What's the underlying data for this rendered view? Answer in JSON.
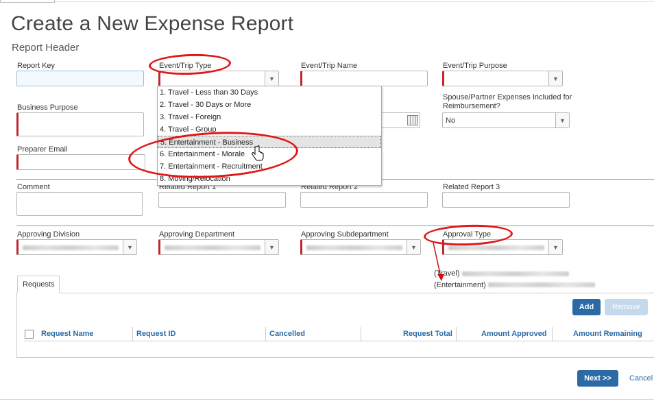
{
  "page": {
    "title": "Create a New Expense Report",
    "subtitle": "Report Header"
  },
  "fields": {
    "report_key": {
      "label": "Report Key",
      "value": ""
    },
    "event_trip_type": {
      "label": "Event/Trip Type",
      "value": ""
    },
    "event_trip_name": {
      "label": "Event/Trip Name",
      "value": ""
    },
    "event_trip_purpose": {
      "label": "Event/Trip Purpose",
      "value": ""
    },
    "business_purpose": {
      "label": "Business Purpose",
      "value": ""
    },
    "spouse_expenses": {
      "label": "Spouse/Partner Expenses Included for Reimbursement?",
      "value": "No"
    },
    "preparer_email": {
      "label": "Preparer Email",
      "value": ""
    },
    "comment": {
      "label": "Comment",
      "value": ""
    },
    "related_report_1": {
      "label": "Related Report 1",
      "value": ""
    },
    "related_report_2": {
      "label": "Related Report 2",
      "value": ""
    },
    "related_report_3": {
      "label": "Related Report 3",
      "value": ""
    },
    "approving_division": {
      "label": "Approving Division"
    },
    "approving_department": {
      "label": "Approving Department"
    },
    "approving_subdepartment": {
      "label": "Approving Subdepartment"
    },
    "approval_type": {
      "label": "Approval Type"
    }
  },
  "trip_type_menu": {
    "options": [
      "1. Travel - Less than 30 Days",
      "2. Travel - 30 Days or More",
      "3. Travel - Foreign",
      "4. Travel - Group",
      "5. Entertainment - Business",
      "6. Entertainment - Morale",
      "7. Entertainment - Recruitment",
      "8. Moving/Relocation"
    ],
    "selected_index": 4
  },
  "approval_notes": {
    "travel": "(Travel)",
    "entertainment": "(Entertainment)"
  },
  "requests": {
    "tab_label": "Requests",
    "add_label": "Add",
    "remove_label": "Remove",
    "columns": [
      "Request Name",
      "Request ID",
      "Cancelled",
      "Request Total",
      "Amount Approved",
      "Amount Remaining"
    ]
  },
  "footer": {
    "next_label": "Next >>",
    "cancel_label": "Cancel"
  },
  "colors": {
    "accent": "#2b6aa5",
    "required": "#c0252c",
    "callout": "#e01818"
  }
}
